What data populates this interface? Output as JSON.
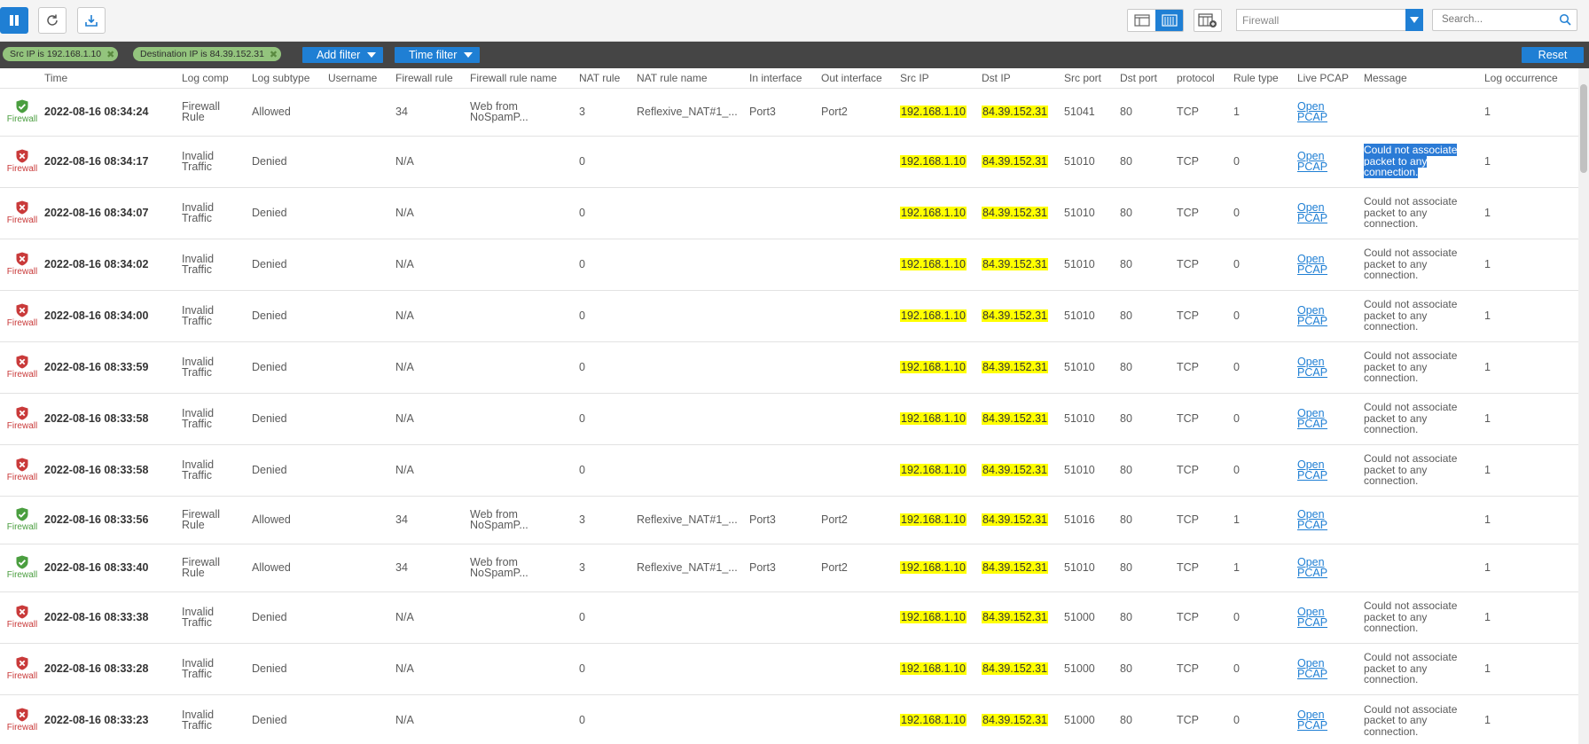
{
  "toolbar": {
    "source_select": "Firewall",
    "search_placeholder": "Search..."
  },
  "filters": {
    "chips": [
      "Src IP is 192.168.1.10",
      "Destination IP is 84.39.152.31"
    ],
    "add_filter": "Add filter",
    "time_filter": "Time filter",
    "reset": "Reset"
  },
  "columns": [
    "Time",
    "Log comp",
    "Log subtype",
    "Username",
    "Firewall rule",
    "Firewall rule name",
    "NAT rule",
    "NAT rule name",
    "In interface",
    "Out interface",
    "Src IP",
    "Dst IP",
    "Src port",
    "Dst port",
    "protocol",
    "Rule type",
    "Live PCAP",
    "Message",
    "Log occurrence"
  ],
  "rows": [
    {
      "status": "allowed",
      "comp_label": "Firewall",
      "time": "2022-08-16 08:34:24",
      "log_comp": [
        "Firewall",
        "Rule"
      ],
      "subtype": "Allowed",
      "username": "",
      "fw_rule": "34",
      "fw_rule_name": [
        "Web from",
        "NoSpamP..."
      ],
      "nat_rule": "3",
      "nat_rule_name": "Reflexive_NAT#1_...",
      "in_if": "Port3",
      "out_if": "Port2",
      "src_ip": "192.168.1.10",
      "dst_ip": "84.39.152.31",
      "src_port": "51041",
      "dst_port": "80",
      "protocol": "TCP",
      "rule_type": "1",
      "pcap": [
        "Open",
        "PCAP"
      ],
      "message": [],
      "occurrence": "1"
    },
    {
      "status": "denied",
      "comp_label": "Firewall",
      "time": "2022-08-16 08:34:17",
      "log_comp": [
        "Invalid",
        "Traffic"
      ],
      "subtype": "Denied",
      "username": "",
      "fw_rule": "N/A",
      "fw_rule_name": [],
      "nat_rule": "0",
      "nat_rule_name": "",
      "in_if": "",
      "out_if": "",
      "src_ip": "192.168.1.10",
      "dst_ip": "84.39.152.31",
      "src_port": "51010",
      "dst_port": "80",
      "protocol": "TCP",
      "rule_type": "0",
      "pcap": [
        "Open",
        "PCAP"
      ],
      "message": [
        "Could not associate",
        "packet to any",
        "connection."
      ],
      "selected": true,
      "occurrence": "1"
    },
    {
      "status": "denied",
      "comp_label": "Firewall",
      "time": "2022-08-16 08:34:07",
      "log_comp": [
        "Invalid",
        "Traffic"
      ],
      "subtype": "Denied",
      "username": "",
      "fw_rule": "N/A",
      "fw_rule_name": [],
      "nat_rule": "0",
      "nat_rule_name": "",
      "in_if": "",
      "out_if": "",
      "src_ip": "192.168.1.10",
      "dst_ip": "84.39.152.31",
      "src_port": "51010",
      "dst_port": "80",
      "protocol": "TCP",
      "rule_type": "0",
      "pcap": [
        "Open",
        "PCAP"
      ],
      "message": [
        "Could not associate",
        "packet to any",
        "connection."
      ],
      "occurrence": "1"
    },
    {
      "status": "denied",
      "comp_label": "Firewall",
      "time": "2022-08-16 08:34:02",
      "log_comp": [
        "Invalid",
        "Traffic"
      ],
      "subtype": "Denied",
      "username": "",
      "fw_rule": "N/A",
      "fw_rule_name": [],
      "nat_rule": "0",
      "nat_rule_name": "",
      "in_if": "",
      "out_if": "",
      "src_ip": "192.168.1.10",
      "dst_ip": "84.39.152.31",
      "src_port": "51010",
      "dst_port": "80",
      "protocol": "TCP",
      "rule_type": "0",
      "pcap": [
        "Open",
        "PCAP"
      ],
      "message": [
        "Could not associate",
        "packet to any",
        "connection."
      ],
      "occurrence": "1"
    },
    {
      "status": "denied",
      "comp_label": "Firewall",
      "time": "2022-08-16 08:34:00",
      "log_comp": [
        "Invalid",
        "Traffic"
      ],
      "subtype": "Denied",
      "username": "",
      "fw_rule": "N/A",
      "fw_rule_name": [],
      "nat_rule": "0",
      "nat_rule_name": "",
      "in_if": "",
      "out_if": "",
      "src_ip": "192.168.1.10",
      "dst_ip": "84.39.152.31",
      "src_port": "51010",
      "dst_port": "80",
      "protocol": "TCP",
      "rule_type": "0",
      "pcap": [
        "Open",
        "PCAP"
      ],
      "message": [
        "Could not associate",
        "packet to any",
        "connection."
      ],
      "occurrence": "1"
    },
    {
      "status": "denied",
      "comp_label": "Firewall",
      "time": "2022-08-16 08:33:59",
      "log_comp": [
        "Invalid",
        "Traffic"
      ],
      "subtype": "Denied",
      "username": "",
      "fw_rule": "N/A",
      "fw_rule_name": [],
      "nat_rule": "0",
      "nat_rule_name": "",
      "in_if": "",
      "out_if": "",
      "src_ip": "192.168.1.10",
      "dst_ip": "84.39.152.31",
      "src_port": "51010",
      "dst_port": "80",
      "protocol": "TCP",
      "rule_type": "0",
      "pcap": [
        "Open",
        "PCAP"
      ],
      "message": [
        "Could not associate",
        "packet to any",
        "connection."
      ],
      "occurrence": "1"
    },
    {
      "status": "denied",
      "comp_label": "Firewall",
      "time": "2022-08-16 08:33:58",
      "log_comp": [
        "Invalid",
        "Traffic"
      ],
      "subtype": "Denied",
      "username": "",
      "fw_rule": "N/A",
      "fw_rule_name": [],
      "nat_rule": "0",
      "nat_rule_name": "",
      "in_if": "",
      "out_if": "",
      "src_ip": "192.168.1.10",
      "dst_ip": "84.39.152.31",
      "src_port": "51010",
      "dst_port": "80",
      "protocol": "TCP",
      "rule_type": "0",
      "pcap": [
        "Open",
        "PCAP"
      ],
      "message": [
        "Could not associate",
        "packet to any",
        "connection."
      ],
      "occurrence": "1"
    },
    {
      "status": "denied",
      "comp_label": "Firewall",
      "time": "2022-08-16 08:33:58",
      "log_comp": [
        "Invalid",
        "Traffic"
      ],
      "subtype": "Denied",
      "username": "",
      "fw_rule": "N/A",
      "fw_rule_name": [],
      "nat_rule": "0",
      "nat_rule_name": "",
      "in_if": "",
      "out_if": "",
      "src_ip": "192.168.1.10",
      "dst_ip": "84.39.152.31",
      "src_port": "51010",
      "dst_port": "80",
      "protocol": "TCP",
      "rule_type": "0",
      "pcap": [
        "Open",
        "PCAP"
      ],
      "message": [
        "Could not associate",
        "packet to any",
        "connection."
      ],
      "occurrence": "1"
    },
    {
      "status": "allowed",
      "comp_label": "Firewall",
      "time": "2022-08-16 08:33:56",
      "log_comp": [
        "Firewall",
        "Rule"
      ],
      "subtype": "Allowed",
      "username": "",
      "fw_rule": "34",
      "fw_rule_name": [
        "Web from",
        "NoSpamP..."
      ],
      "nat_rule": "3",
      "nat_rule_name": "Reflexive_NAT#1_...",
      "in_if": "Port3",
      "out_if": "Port2",
      "src_ip": "192.168.1.10",
      "dst_ip": "84.39.152.31",
      "src_port": "51016",
      "dst_port": "80",
      "protocol": "TCP",
      "rule_type": "1",
      "pcap": [
        "Open",
        "PCAP"
      ],
      "message": [],
      "occurrence": "1"
    },
    {
      "status": "allowed",
      "comp_label": "Firewall",
      "time": "2022-08-16 08:33:40",
      "log_comp": [
        "Firewall",
        "Rule"
      ],
      "subtype": "Allowed",
      "username": "",
      "fw_rule": "34",
      "fw_rule_name": [
        "Web from",
        "NoSpamP..."
      ],
      "nat_rule": "3",
      "nat_rule_name": "Reflexive_NAT#1_...",
      "in_if": "Port3",
      "out_if": "Port2",
      "src_ip": "192.168.1.10",
      "dst_ip": "84.39.152.31",
      "src_port": "51010",
      "dst_port": "80",
      "protocol": "TCP",
      "rule_type": "1",
      "pcap": [
        "Open",
        "PCAP"
      ],
      "message": [],
      "occurrence": "1"
    },
    {
      "status": "denied",
      "comp_label": "Firewall",
      "time": "2022-08-16 08:33:38",
      "log_comp": [
        "Invalid",
        "Traffic"
      ],
      "subtype": "Denied",
      "username": "",
      "fw_rule": "N/A",
      "fw_rule_name": [],
      "nat_rule": "0",
      "nat_rule_name": "",
      "in_if": "",
      "out_if": "",
      "src_ip": "192.168.1.10",
      "dst_ip": "84.39.152.31",
      "src_port": "51000",
      "dst_port": "80",
      "protocol": "TCP",
      "rule_type": "0",
      "pcap": [
        "Open",
        "PCAP"
      ],
      "message": [
        "Could not associate",
        "packet to any",
        "connection."
      ],
      "occurrence": "1"
    },
    {
      "status": "denied",
      "comp_label": "Firewall",
      "time": "2022-08-16 08:33:28",
      "log_comp": [
        "Invalid",
        "Traffic"
      ],
      "subtype": "Denied",
      "username": "",
      "fw_rule": "N/A",
      "fw_rule_name": [],
      "nat_rule": "0",
      "nat_rule_name": "",
      "in_if": "",
      "out_if": "",
      "src_ip": "192.168.1.10",
      "dst_ip": "84.39.152.31",
      "src_port": "51000",
      "dst_port": "80",
      "protocol": "TCP",
      "rule_type": "0",
      "pcap": [
        "Open",
        "PCAP"
      ],
      "message": [
        "Could not associate",
        "packet to any",
        "connection."
      ],
      "occurrence": "1"
    },
    {
      "status": "denied",
      "comp_label": "Firewall",
      "time": "2022-08-16 08:33:23",
      "log_comp": [
        "Invalid",
        "Traffic"
      ],
      "subtype": "Denied",
      "username": "",
      "fw_rule": "N/A",
      "fw_rule_name": [],
      "nat_rule": "0",
      "nat_rule_name": "",
      "in_if": "",
      "out_if": "",
      "src_ip": "192.168.1.10",
      "dst_ip": "84.39.152.31",
      "src_port": "51000",
      "dst_port": "80",
      "protocol": "TCP",
      "rule_type": "0",
      "pcap": [
        "Open",
        "PCAP"
      ],
      "message": [
        "Could not associate",
        "packet to any",
        "connection."
      ],
      "occurrence": "1"
    }
  ],
  "colors": {
    "accent": "#1f7fd4",
    "allowed": "#4a9e3f",
    "denied": "#c93a3a",
    "highlight": "#ffff00",
    "filter_chip": "#93c47d"
  }
}
